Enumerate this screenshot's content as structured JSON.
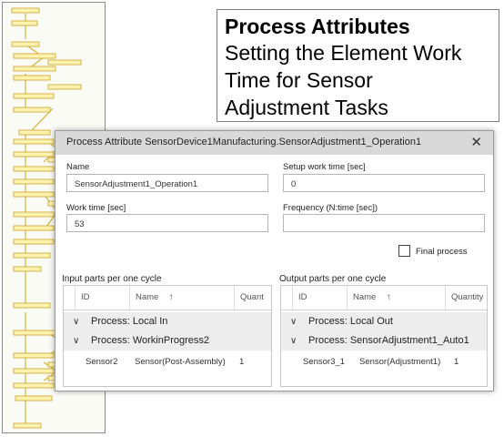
{
  "caption": {
    "title": "Process Attributes",
    "subtitle_line1": "Setting the Element Work",
    "subtitle_line2": "Time for Sensor",
    "subtitle_line3": "Adjustment Tasks"
  },
  "dialog": {
    "title": "Process Attribute SensorDevice1Manufacturing.SensorAdjustment1_Operation1",
    "close_glyph": "✕",
    "name_label": "Name",
    "name_value": "SensorAdjustment1_Operation1",
    "setup_label": "Setup work time [sec]",
    "setup_value": "0",
    "work_label": "Work time [sec]",
    "work_value": "53",
    "frequency_label": "Frequency (N:time [sec])",
    "frequency_value": "",
    "final_label": "Final process",
    "final_checked": false
  },
  "input_parts": {
    "heading": "Input parts per one cycle",
    "columns": [
      "ID",
      "Name",
      "Quant"
    ],
    "sort_glyph": "↑",
    "groups": [
      "Process: Local In",
      "Process: WorkinProgress2"
    ],
    "rows": [
      [
        "Sensor2",
        "Sensor(Post-Assembly)",
        "1"
      ]
    ]
  },
  "output_parts": {
    "heading": "Output parts per one cycle",
    "columns": [
      "ID",
      "Name",
      "Quantity"
    ],
    "sort_glyph": "↑",
    "groups": [
      "Process: Local Out",
      "Process: SensorAdjustment1_Auto1"
    ],
    "rows": [
      [
        "Sensor3_1",
        "Sensor(Adjustment1)",
        "1"
      ]
    ]
  },
  "icons": {
    "collapse": "chevron-down-icon",
    "sort": "sort-ascending-icon",
    "close": "close-icon"
  }
}
